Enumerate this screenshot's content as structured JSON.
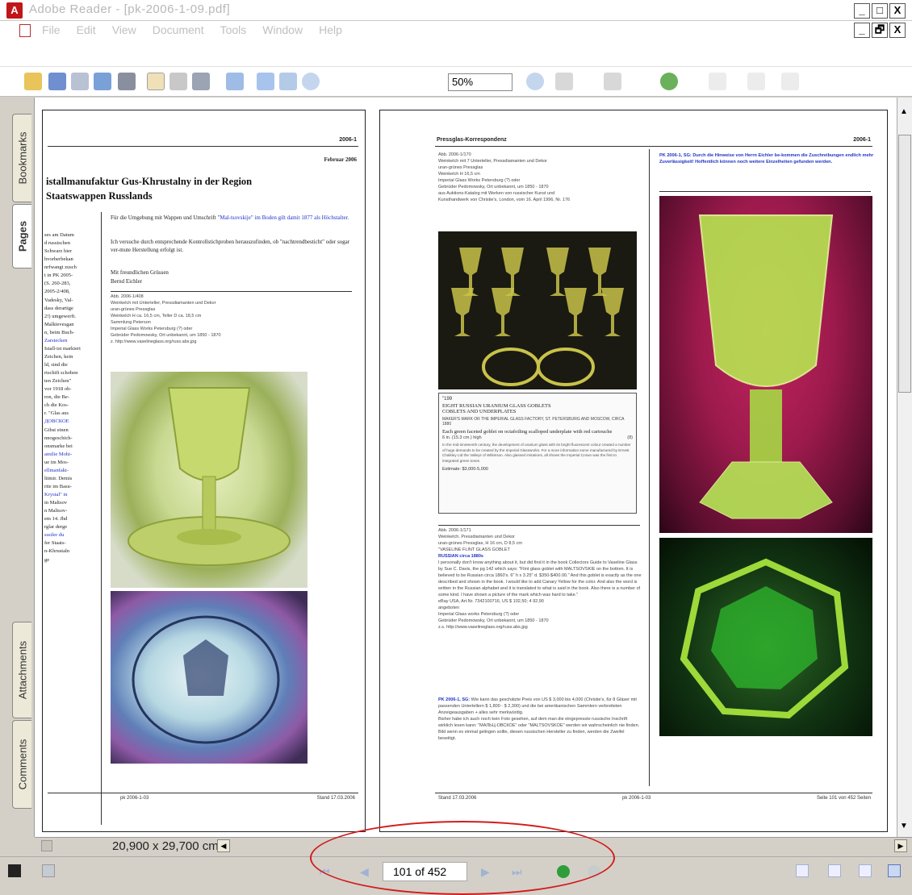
{
  "window": {
    "title": "Adobe Reader - [pk-2006-1-09.pdf]",
    "controls": [
      "_",
      "□",
      "X"
    ],
    "mdi_controls": [
      "_",
      "🗗",
      "X"
    ]
  },
  "menu": [
    "File",
    "Edit",
    "View",
    "Document",
    "Tools",
    "Window",
    "Help"
  ],
  "toolbar": {
    "zoom_value": "50%"
  },
  "sidebar": {
    "tabs": [
      "Bookmarks",
      "Pages",
      "Attachments",
      "Comments"
    ]
  },
  "left_page": {
    "header_right": "2006-1",
    "date": "Februar 2006",
    "heading_line1": "istallmanufaktur Gus-Khrustalny in der Region",
    "heading_line2": "Staatswappen Russlands",
    "right_col_par1_a": "Für die Umgebung mit Wappen und Umschrift ",
    "right_col_par1_b": "\"Mal-tsovskije\" im Boden gilt damit 1877 als Höchstalter.",
    "right_col_par2": "Ich versuche durch entsprechende Kontrollstichproben herauszufinden, ob \"nachtrendbesticht\" oder sogar ver-mute Herstellung erfolgt ist.",
    "right_col_par3": "Mit freundlichen Grüssen",
    "right_col_par4": "Bernd Eichler",
    "caption": "Abb. 2006-1/408\nWeinkelch mit Unterteller, Pressdiamanten und Dekor\nuran-grünes Pressglas\nWeinkelch H ca. 16,5 cm, Teller D ca. 18,5 cm\nSammlung Peterson\nImperial Glass Works Petersburg (?) oder\nGebrüder Pedomowsky, Ort unbekannt, um 1850 - 1870\nz. http://www.vaselineglass.org/russ.abs.jpg",
    "left_col_lines": [
      "ses am Datum",
      "d russischen",
      "Schwarz hier",
      "hvorherbekan",
      "nrfwangt zusch",
      "t in PK 2005-",
      "(S. 260-283,",
      "2005-2/408,",
      "Vadesky, Val-",
      "dass derartige",
      "2!) umgewerft.",
      "Malkievesgan",
      "n, beim Buch-",
      "Zarstecken",
      "Istall-ist markiert",
      "Zeichen, kein",
      "ld, sind die",
      "rtschift schoben",
      "ten Zeichen\"",
      "vor 1918 ob-",
      "ron, die Be-",
      "ch die Kos-",
      "r. \"Glas aus",
      "ДОВСКОЕ",
      "Gibst einen",
      "nnogeschich-",
      "onsmarke bei",
      "amilie Mohi-",
      "ue im Mos-",
      "ellmanfakt-",
      "ltimir. Demis",
      "rite im Basu-",
      "Krystal\" in",
      "in Maltsov",
      "n Maltsov-",
      "em 14. Jhd",
      "rglar derge",
      "ssstler du",
      "fer Staats-",
      "n-Khrustaln",
      "ge"
    ],
    "footer_left": "pk 2006-1-03",
    "footer_right": "Stand 17.03.2006"
  },
  "right_page": {
    "header_left": "Pressglas-Korrespondenz",
    "header_right": "2006-1",
    "caption1": "Abb. 2006-1/170\nWeinkelch mit 7 Unterteller, Pressdiamanten und Dekor\nuran-grünes Pressglas\nWeinkelch H 16,5 cm\nImperial Glass Works Petersburg (?) oder\nGebrüder Pedomowsky, Ort unbekannt, um 1850 - 1870\naus Auktions-Katalog mit Werken von russischer Kunst und\nKunsthandwerk von Christie's, London, vom 16. April 1996, Nr. 176",
    "blue_note": "PK 2006-1, SG: Durch die Hinweise von Herrn Eichler be-kommen die Zuschreibungen endlich mehr Zuverlässigkeit! Hoffentlich können noch weitere Einzelheiten gefunden werden.",
    "catalog_number": "\"199",
    "catalog_title": "EIGHT RUSSIAN URANIUM GLASS GOBLETS\nCOBLETS AND UNDERPLATES",
    "catalog_sub": "MAKER'S MARK OR THE IMPERIAL GLASS FACTORY, ST. PETERSBURG AND MOSCOW, CIRCA 1880",
    "catalog_body": "Each green faceted goblet on octafoiling scalloped underplate with red cartouche",
    "catalog_size": "6 in. (15.3 cm.) high",
    "catalog_count": "(8)",
    "catalog_note": "In the mid-nineteenth century, the development of uranium glass with its bright fluorescent colour created a number of huge demands to be created by the Imperial Glassworks. For a more information some manufactured by Ernest Chalkley Ltd the Valleys of Wilkinson. Also glassed imitations, all shows the Imperial Crown was the first to integrated green tones.",
    "catalog_est": "Estimate: $3,000-5,000",
    "caption2": "Abb. 2006-1/171\nWeinkelch, Pressdiamanten und Dekor\nuran-grünes Pressglas, H 16 cm, D 8,5 cm\n\"VASELINE FLINT GLASS GOBLET",
    "caption2_blue": "RUSSIAN circa 1880s",
    "caption2_body": "I personally don't know anything about it, but did find it in the book Collectors Guide to Vaseline Glass by Sue C. Davis, the pg 142 which says: \"Flint glass goblet with MALTSOVSKIE on the bottom. It is believed to be Russian circa 1860's. 6\" h x 3.25\" d. $350-$400.00.\" And this goblet is exactly as the one described and shown in the book. I would like to add Canary Yellow for the color. And also the word is written in the Russian alphabet and it is translated to what is said in the book. Also there is a number of some kind. I have shown a picture of the mark which was hard to take.\"\neBay USA, Art.Nr. 7342100716, US $ 102,50; 4 92,90\nangeboten\nImperial Glass works Petersburg (?) oder\nGebrüder Pedomowsky, Ort unbekannt, um 1850 - 1870\nz.s. http://www.vaselineglass.org/russ.abs.jpg",
    "caption3_blue": "PK 2006-1, SG:",
    "caption3_body": "Wie kann das geschätzte Preis von US $ 3,000 bis 4,000 (Christie's, für 8 Gläser mit passenden Untertellern $ 1,800 - $ 2,300) und die bei amerikanischen Sammlern verbreiteten Anzeigeausgaben + alles sehr merkwürdig.\nBisher habe ich auch noch kein Foto gesehen, auf dem man die eingepresste russische Inschrift wirklich lesen kann: \"МАЛЬЦ-ОВСКОЕ\" oder \"MALTSOVSKOE\" werden wir wahrscheinlich nie finden.\nBild wenn es einmal gelingen sollte, diesen russischen Hersteller zu finden, werden die Zweifel beseitigt.",
    "footer_left": "Stand 17.03.2006",
    "footer_mid": "pk 2006-1-03",
    "footer_right": "Seite 101 von 452 Seiten"
  },
  "bottom": {
    "page_size": "20,900 x 29,700 cm",
    "page_indicator": "101 of 452"
  }
}
